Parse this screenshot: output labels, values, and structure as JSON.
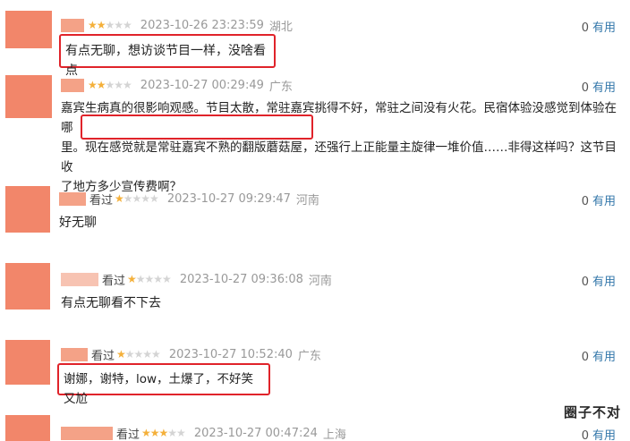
{
  "useful_label": "有用",
  "seen_label": "看过",
  "reviews": [
    {
      "stars": "★★",
      "stars_off": "★★★",
      "time": "2023-10-26 23:23:59",
      "location": "湖北",
      "useful_count": "0",
      "text": "有点无聊，想访谈节目一样，没啥看点"
    },
    {
      "stars": "★★",
      "stars_off": "★★★",
      "time": "2023-10-27 00:29:49",
      "location": "广东",
      "useful_count": "0",
      "text_line1": "嘉宾生病真的很影响观感。节目太散，常驻嘉宾挑得不好，常驻之间没有火花。民宿体验没感觉到体验在哪",
      "text_line2_pre": "里。",
      "text_line2_hl": "现在感觉就是常驻嘉宾不熟的翻版蘑菇屋，",
      "text_line2_post": "还强行上正能量主旋律一堆价值……非得这样吗？这节目收",
      "text_line3": "了地方多少宣传费啊？"
    },
    {
      "stars": "★",
      "stars_off": "★★★★",
      "time": "2023-10-27 09:29:47",
      "location": "河南",
      "useful_count": "0",
      "text": "好无聊"
    },
    {
      "stars": "★",
      "stars_off": "★★★★",
      "time": "2023-10-27 09:36:08",
      "location": "河南",
      "useful_count": "0",
      "text": "有点无聊看不下去"
    },
    {
      "stars": "★",
      "stars_off": "★★★★",
      "time": "2023-10-27 10:52:40",
      "location": "广东",
      "useful_count": "0",
      "text": "谢娜，谢特，low，土爆了，不好笑又尬"
    },
    {
      "stars": "★★★",
      "stars_off": "★★",
      "time": "2023-10-27 00:47:24",
      "location": "上海",
      "useful_count": "0"
    }
  ],
  "watermark": "圈子不对"
}
